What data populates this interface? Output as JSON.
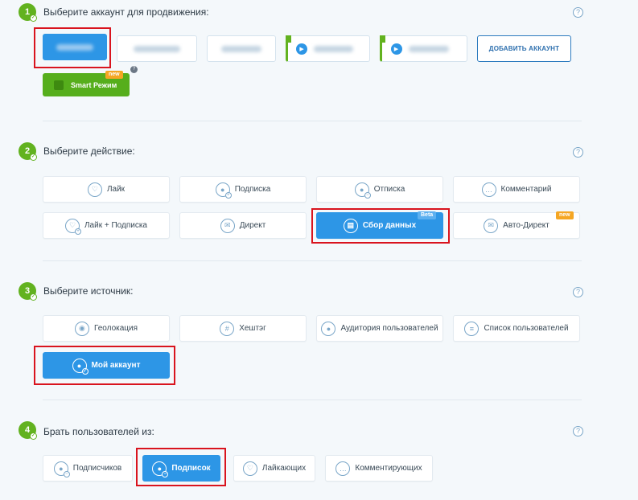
{
  "help_icon": "?",
  "step1": {
    "number": "1",
    "title": "Выберите аккаунт для продвижения:",
    "add_account_label": "ДОБАВИТЬ АККАУНТ",
    "smart_label": "Smart Режим",
    "smart_badge": "new"
  },
  "step2": {
    "number": "2",
    "title": "Выберите действие:",
    "actions": [
      {
        "label": "Лайк",
        "icon": "heart-icon"
      },
      {
        "label": "Подписка",
        "icon": "user-plus-icon"
      },
      {
        "label": "Отписка",
        "icon": "user-minus-icon"
      },
      {
        "label": "Комментарий",
        "icon": "comment-icon"
      },
      {
        "label": "Лайк + Подписка",
        "icon": "heart-plus-icon"
      },
      {
        "label": "Директ",
        "icon": "mail-icon"
      },
      {
        "label": "Сбор данных",
        "icon": "data-collect-icon",
        "badge": "Beta",
        "active": true
      },
      {
        "label": "Авто-Директ",
        "icon": "auto-mail-icon",
        "badge": "new"
      }
    ]
  },
  "step3": {
    "number": "3",
    "title": "Выберите источник:",
    "sources": [
      {
        "label": "Геолокация",
        "icon": "location-icon"
      },
      {
        "label": "Хештэг",
        "icon": "hashtag-icon"
      },
      {
        "label": "Аудитория пользователей",
        "icon": "audience-icon"
      },
      {
        "label": "Список пользователей",
        "icon": "list-icon"
      },
      {
        "label": "Мой аккаунт",
        "icon": "my-account-icon",
        "active": true
      }
    ]
  },
  "step4": {
    "number": "4",
    "title": "Брать пользователей из:",
    "options": [
      {
        "label": "Подписчиков",
        "icon": "followers-icon"
      },
      {
        "label": "Подписок",
        "icon": "following-icon",
        "active": true
      },
      {
        "label": "Лайкающих",
        "icon": "likers-icon"
      },
      {
        "label": "Комментирующих",
        "icon": "commenters-icon"
      }
    ]
  },
  "colors": {
    "accent": "#2d96e6",
    "green": "#62b21f",
    "highlight": "#d9141e",
    "new_badge": "#f5a623"
  }
}
